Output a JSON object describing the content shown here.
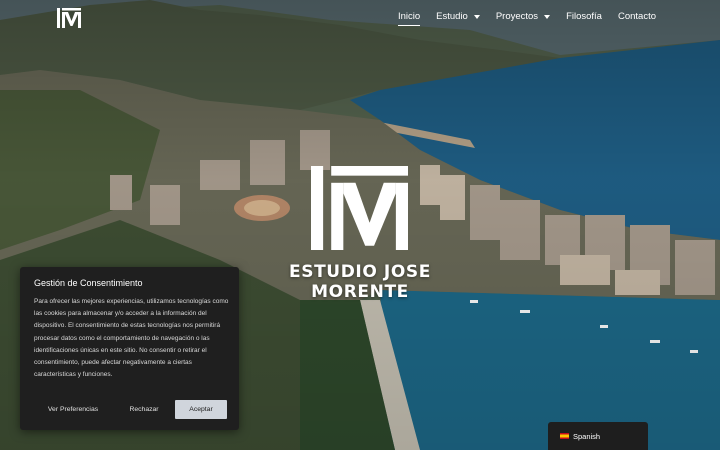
{
  "nav": {
    "items": [
      {
        "label": "Inicio",
        "active": true,
        "has_dropdown": false
      },
      {
        "label": "Estudio",
        "active": false,
        "has_dropdown": true
      },
      {
        "label": "Proyectos",
        "active": false,
        "has_dropdown": true
      },
      {
        "label": "Filosofía",
        "active": false,
        "has_dropdown": false
      },
      {
        "label": "Contacto",
        "active": false,
        "has_dropdown": false
      }
    ]
  },
  "hero": {
    "title": "ESTUDIO JOSE MORENTE",
    "logo_icon": "im-monogram-logo"
  },
  "consent": {
    "title": "Gestión de Consentimiento",
    "body": "Para ofrecer las mejores experiencias, utilizamos tecnologías como las cookies para almacenar y/o acceder a la información del dispositivo. El consentimiento de estas tecnologías nos permitirá procesar datos como el comportamiento de navegación o las identificaciones únicas en este sitio. No consentir o retirar el consentimiento, puede afectar negativamente a ciertas características y funciones.",
    "buttons": {
      "preferences": "Ver Preferencias",
      "reject": "Rechazar",
      "accept": "Aceptar"
    }
  },
  "language": {
    "label": "Spanish",
    "flag_icon": "spain-flag-icon"
  },
  "colors": {
    "consent_bg": "#1f1f1f",
    "accept_bg": "#d0d5dc",
    "text": "#ffffff"
  }
}
